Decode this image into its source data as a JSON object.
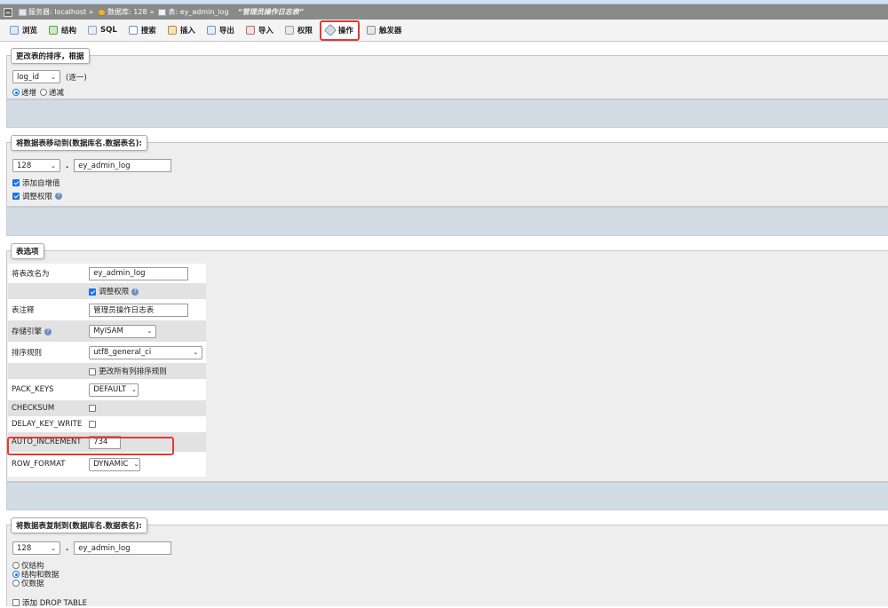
{
  "breadcrumb": {
    "server_label": "服务器: localhost",
    "db_label": "数据库: 128",
    "table_label": "表: ey_admin_log",
    "sep": "»",
    "comment": "“管理员操作日志表”"
  },
  "tabs": [
    {
      "label": "浏览"
    },
    {
      "label": "结构"
    },
    {
      "label": "SQL"
    },
    {
      "label": "搜索"
    },
    {
      "label": "插入"
    },
    {
      "label": "导出"
    },
    {
      "label": "导入"
    },
    {
      "label": "权限"
    },
    {
      "label": "操作"
    },
    {
      "label": "触发器"
    }
  ],
  "sort_section": {
    "legend": "更改表的排序，根据",
    "column_select": "log_id",
    "single_label": "(逐一)",
    "asc_label": "递增",
    "desc_label": "递减"
  },
  "move_section": {
    "legend": "将数据表移动到(数据库名.数据表名):",
    "db_select": "128",
    "dot": ".",
    "table_value": "ey_admin_log",
    "add_auto_increment": "添加自增值",
    "adjust_privileges": "调整权限"
  },
  "table_options": {
    "legend": "表选项",
    "rename_label": "将表改名为",
    "rename_value": "ey_admin_log",
    "adjust_privileges": "调整权限",
    "comment_label": "表注释",
    "comment_value": "管理员操作日志表",
    "engine_label": "存储引擎",
    "engine_value": "MyISAM",
    "collation_label": "排序规则",
    "collation_value": "utf8_general_ci",
    "change_all_collation": "更改所有列排序规则",
    "pack_keys_label": "PACK_KEYS",
    "pack_keys_value": "DEFAULT",
    "checksum_label": "CHECKSUM",
    "delay_key_write_label": "DELAY_KEY_WRITE",
    "auto_increment_label": "AUTO_INCREMENT",
    "auto_increment_value": "734",
    "row_format_label": "ROW_FORMAT",
    "row_format_value": "DYNAMIC"
  },
  "copy_section": {
    "legend": "将数据表复制到(数据库名.数据表名):",
    "db_select": "128",
    "dot": ".",
    "table_value": "ey_admin_log",
    "opt_structure": "仅结构",
    "opt_structure_data": "结构和数据",
    "opt_data": "仅数据",
    "add_drop_table": "添加 DROP TABLE"
  },
  "help_glyph": "?",
  "caret_glyph": "⌄",
  "colors": {
    "highlight": "#e53935",
    "accent": "#1a73e8",
    "footer_bar": "#d3dce5"
  }
}
